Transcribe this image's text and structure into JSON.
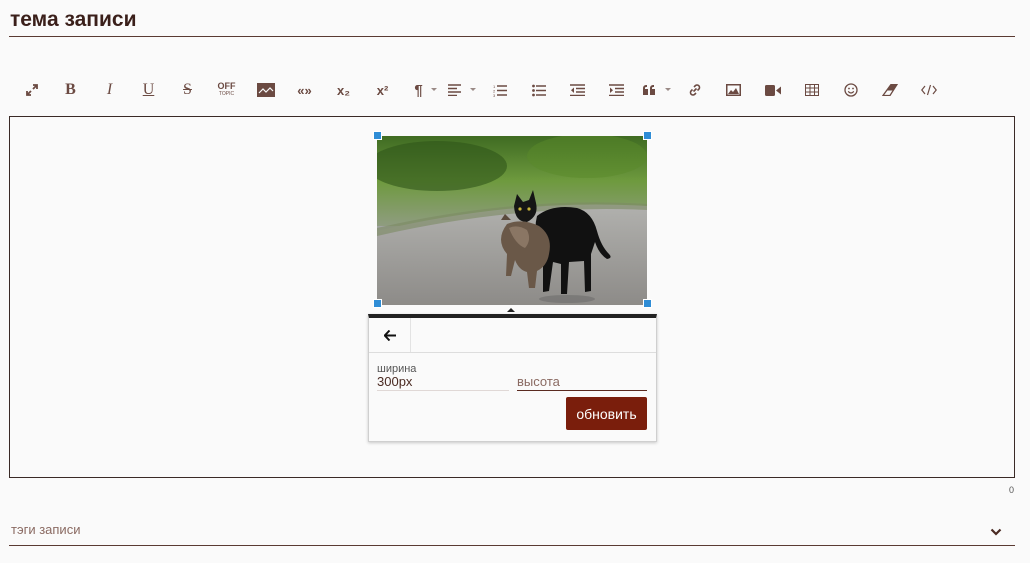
{
  "post": {
    "title": "тема записи"
  },
  "toolbar": {
    "bold_label": "B",
    "italic_label": "I",
    "underline_label": "U",
    "strike_label": "S",
    "offtopic_label": "OFF",
    "offtopic_sub": "TOPIC",
    "quote_label": "«»",
    "subscript_label": "x₂",
    "superscript_label": "x²",
    "paragraph_label": "¶",
    "icons": [
      "fullscreen-icon",
      "bold-icon",
      "italic-icon",
      "underline-icon",
      "strikethrough-icon",
      "offtopic-icon",
      "spoiler-icon",
      "quote-icon",
      "subscript-icon",
      "superscript-icon",
      "paragraph-icon",
      "align-icon",
      "ordered-list-icon",
      "unordered-list-icon",
      "outdent-icon",
      "indent-icon",
      "blockquote-icon",
      "link-icon",
      "image-icon",
      "video-icon",
      "table-icon",
      "emoji-icon",
      "clear-format-icon",
      "code-view-icon"
    ]
  },
  "image_popup": {
    "width_label": "ширина",
    "width_value": "300px",
    "height_placeholder": "высота",
    "update_button": "обновить"
  },
  "editor": {
    "char_count": "0"
  },
  "tags": {
    "label": "тэги записи"
  },
  "colors": {
    "accent": "#7a1e0c",
    "handle": "#2f8dd6",
    "text": "#4a2a22"
  }
}
